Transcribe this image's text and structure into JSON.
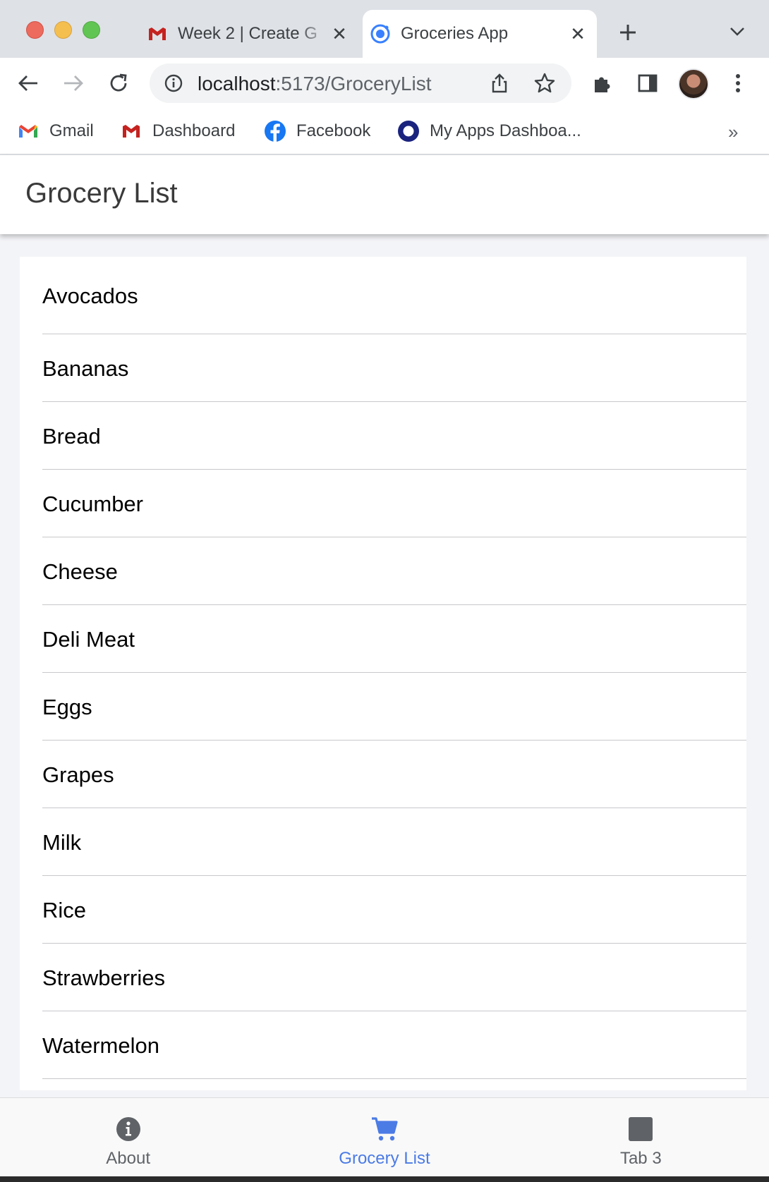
{
  "browser": {
    "tabs": [
      {
        "title": "Week 2 | Create G",
        "favicon": "gmail-icon",
        "active": false
      },
      {
        "title": "Groceries App",
        "favicon": "ionic-icon",
        "active": true
      }
    ],
    "url_host": "localhost",
    "url_path": ":5173/GroceryList",
    "bookmarks": [
      {
        "label": "Gmail",
        "icon": "gmail-icon"
      },
      {
        "label": "Dashboard",
        "icon": "gmail-icon"
      },
      {
        "label": "Facebook",
        "icon": "facebook-icon"
      },
      {
        "label": "My Apps Dashboa...",
        "icon": "okta-icon"
      }
    ],
    "more_bookmarks": "»",
    "close_glyph": "✕"
  },
  "header": {
    "title": "Grocery List"
  },
  "groceries": [
    "Avocados",
    "Bananas",
    "Bread",
    "Cucumber",
    "Cheese",
    "Deli Meat",
    "Eggs",
    "Grapes",
    "Milk",
    "Rice",
    "Strawberries",
    "Watermelon"
  ],
  "tabbar": [
    {
      "label": "About",
      "icon": "info-icon",
      "selected": false
    },
    {
      "label": "Grocery List",
      "icon": "cart-icon",
      "selected": true
    },
    {
      "label": "Tab 3",
      "icon": "square-icon",
      "selected": false
    }
  ],
  "colors": {
    "accent": "#4b7be5",
    "tab_inactive": "#5f6368",
    "content_bg": "#f3f4f7"
  }
}
